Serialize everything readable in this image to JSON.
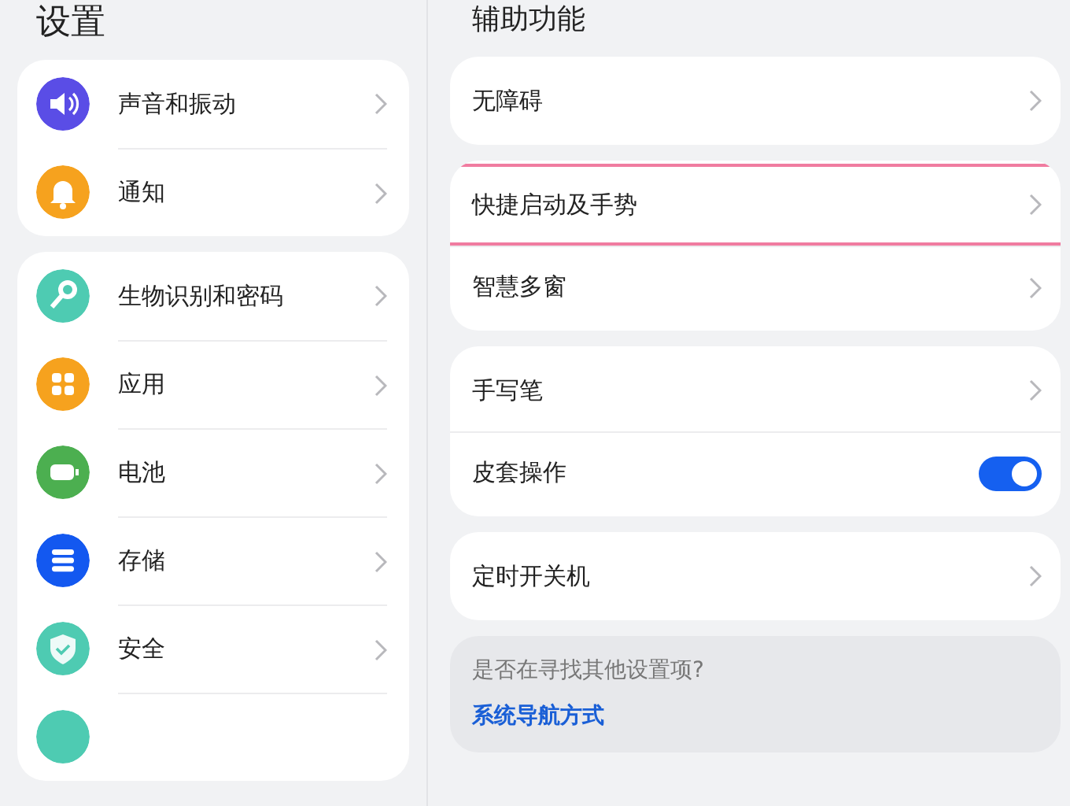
{
  "settings_pane": {
    "title": "设置",
    "groups": [
      {
        "items": [
          {
            "kind": "sound",
            "color": "#5a4de6",
            "label": "声音和振动"
          },
          {
            "kind": "bell",
            "color": "#f6a21e",
            "label": "通知"
          }
        ]
      },
      {
        "items": [
          {
            "kind": "key",
            "color": "#4ecbb2",
            "label": "生物识别和密码"
          },
          {
            "kind": "apps",
            "color": "#f6a21e",
            "label": "应用"
          },
          {
            "kind": "battery",
            "color": "#4caf50",
            "label": "电池"
          },
          {
            "kind": "storage",
            "color": "#1358f0",
            "label": "存储"
          },
          {
            "kind": "shield",
            "color": "#4ecbb2",
            "label": "安全"
          },
          {
            "kind": "blank",
            "color": "#4ecbb2"
          }
        ]
      }
    ]
  },
  "accessibility_pane": {
    "title": "辅助功能",
    "groups": [
      {
        "items": [
          {
            "kind": "link",
            "label": "无障碍",
            "selected": false
          }
        ]
      },
      {
        "items": [
          {
            "kind": "link",
            "label": "快捷启动及手势",
            "selected": true
          },
          {
            "kind": "link",
            "label": "智慧多窗",
            "selected": false
          }
        ]
      },
      {
        "items": [
          {
            "kind": "link",
            "label": "手写笔",
            "selected": false
          },
          {
            "kind": "toggle",
            "label": "皮套操作",
            "on": true,
            "selected": false
          }
        ]
      },
      {
        "items": [
          {
            "kind": "link",
            "label": "定时开关机",
            "selected": false
          }
        ]
      }
    ],
    "suggestion": {
      "question": "是否在寻找其他设置项?",
      "link": "系统导航方式"
    }
  }
}
